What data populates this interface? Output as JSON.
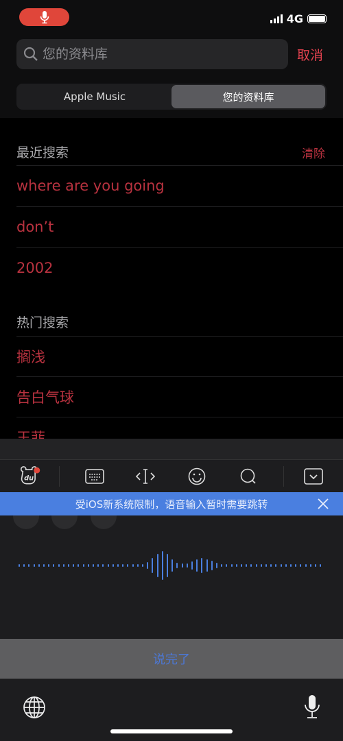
{
  "status_bar": {
    "network": "4G",
    "mic_active_color": "#e0463a"
  },
  "search": {
    "placeholder": "您的资料库",
    "value": "",
    "cancel_label": "取消"
  },
  "segmented": {
    "options": [
      "Apple Music",
      "您的资料库"
    ],
    "selected": "您的资料库"
  },
  "recent": {
    "title": "最近搜索",
    "clear_label": "清除",
    "items": [
      "where are you going",
      "don’t",
      "2002"
    ]
  },
  "trending": {
    "title": "热门搜索",
    "items": [
      "搁浅",
      "告白气球",
      "王菲"
    ]
  },
  "keyboard": {
    "toolbar_icons": [
      "du-logo-icon",
      "keyboard-icon",
      "cursor-move-icon",
      "emoji-icon",
      "search-icon",
      "collapse-keyboard-icon"
    ],
    "banner_text": "受iOS新系统限制，语音输入暂时需要跳转",
    "done_label": "说完了",
    "accent_color": "#4a7fe0"
  },
  "colors": {
    "accent_red": "#e4424f",
    "list_red": "#b8323f"
  }
}
